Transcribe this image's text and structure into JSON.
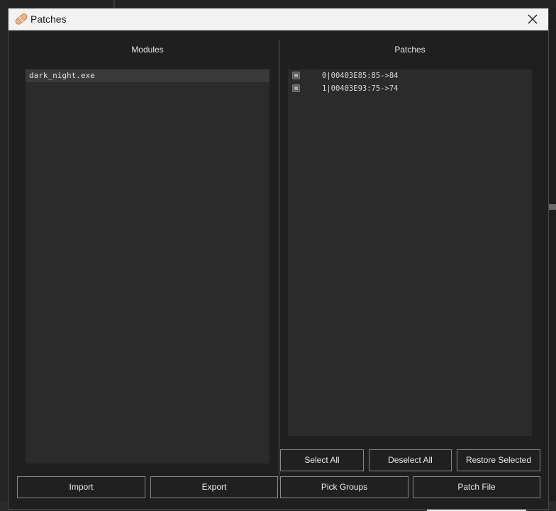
{
  "dialog": {
    "title": "Patches",
    "close_symbol": "close-icon",
    "icon": "bandage-icon"
  },
  "modules_panel": {
    "heading": "Modules",
    "items": [
      "dark_night.exe"
    ]
  },
  "patches_panel": {
    "heading": "Patches",
    "items": [
      {
        "index": "0",
        "text": "0|00403E85:85->84"
      },
      {
        "index": "1",
        "text": "1|00403E93:75->74"
      }
    ]
  },
  "buttons": {
    "select_all": "Select All",
    "deselect_all": "Deselect All",
    "restore_selected": "Restore Selected",
    "import": "Import",
    "export": "Export",
    "pick_groups": "Pick Groups",
    "patch_file": "Patch File"
  },
  "colors": {
    "dialog_bg": "#1f1f1f",
    "list_bg": "#2b2b2b",
    "selected_row": "#3a3a3a",
    "titlebar_bg": "#f3f3f3"
  }
}
